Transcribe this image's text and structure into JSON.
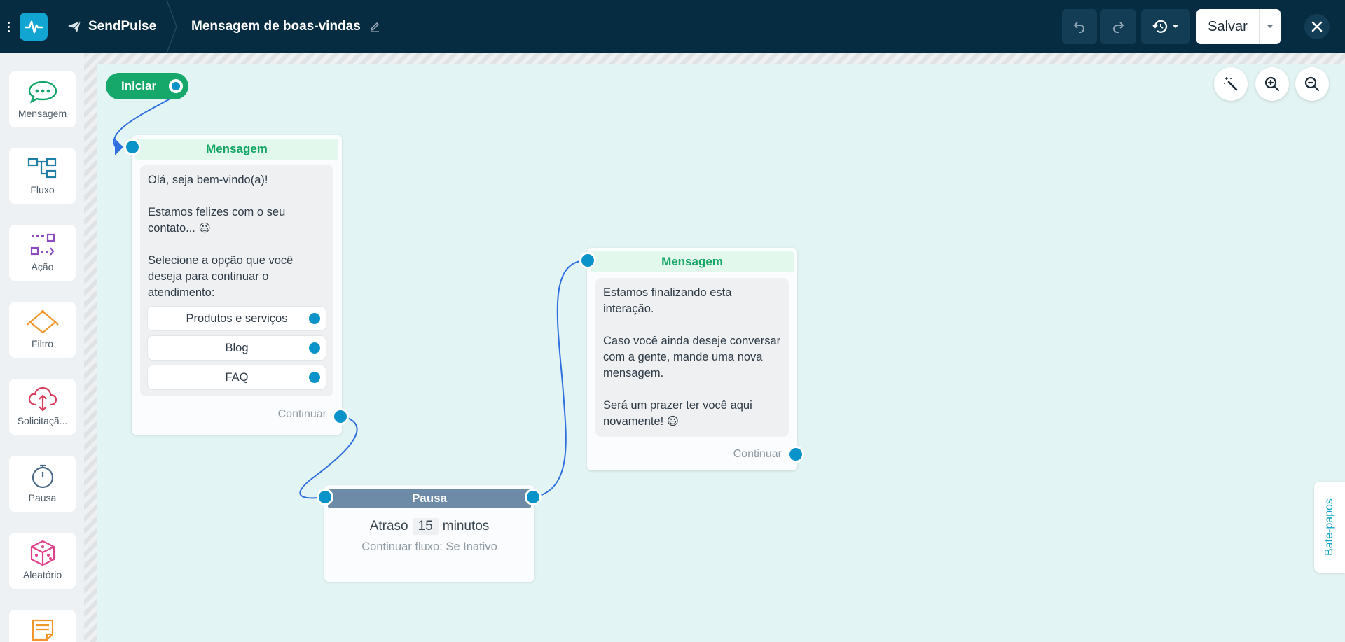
{
  "header": {
    "brand": "SendPulse",
    "title": "Mensagem de boas-vindas",
    "save_label": "Salvar"
  },
  "icons": {
    "menu": "more-vertical-icon",
    "logo": "pulse-logo-icon",
    "brand": "paper-plane-icon",
    "edit": "pencil-icon",
    "undo": "undo-icon",
    "redo": "redo-icon",
    "history": "history-icon",
    "close": "close-icon",
    "magic": "magic-wand-icon",
    "zoom_in": "zoom-in-icon",
    "zoom_out": "zoom-out-icon"
  },
  "sidebar": {
    "items": [
      {
        "label": "Mensagem",
        "icon": "chat-bubble-icon",
        "color": "#16a86a"
      },
      {
        "label": "Fluxo",
        "icon": "flow-icon",
        "color": "#1f7ea6"
      },
      {
        "label": "Ação",
        "icon": "action-icon",
        "color": "#8b4cc0"
      },
      {
        "label": "Filtro",
        "icon": "filter-icon",
        "color": "#f0962a"
      },
      {
        "label": "Solicitaçã...",
        "icon": "cloud-request-icon",
        "color": "#d9405e"
      },
      {
        "label": "Pausa",
        "icon": "stopwatch-icon",
        "color": "#4a6a88"
      },
      {
        "label": "Aleatório",
        "icon": "dice-icon",
        "color": "#e0408c"
      },
      {
        "label": "",
        "icon": "note-icon",
        "color": "#f0962a"
      }
    ]
  },
  "canvas": {
    "start_label": "Iniciar",
    "message1": {
      "header": "Mensagem",
      "paragraphs": [
        "Olá, seja bem-vindo(a)!",
        "Estamos felizes com o seu contato... 😃",
        "Selecione a opção que você deseja para continuar o atendimento:"
      ],
      "buttons": [
        "Produtos e serviços",
        "Blog",
        "FAQ"
      ],
      "continue": "Continuar"
    },
    "pause": {
      "header": "Pausa",
      "delay_prefix": "Atraso",
      "delay_value": "15",
      "delay_unit": "minutos",
      "continue_flow": "Continuar fluxo: Se Inativo"
    },
    "message2": {
      "header": "Mensagem",
      "paragraphs": [
        "Estamos finalizando esta interação.",
        "Caso você ainda deseje conversar com a gente, mande uma nova mensagem.",
        "Será um prazer ter você aqui novamente! 😃"
      ],
      "continue": "Continuar"
    }
  },
  "chats_tab": "Bate-papos",
  "colors": {
    "header_bg": "#062c42",
    "canvas_bg": "#e2f4f3",
    "accent_green": "#16a86a",
    "port_blue": "#0a93c9",
    "wire": "#2f6fe0"
  }
}
